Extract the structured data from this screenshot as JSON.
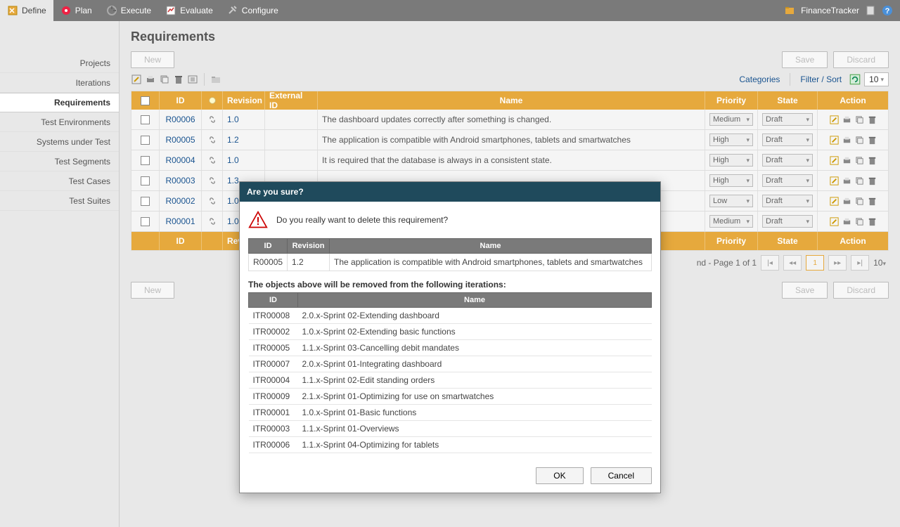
{
  "toolbar": {
    "tabs": [
      "Define",
      "Plan",
      "Execute",
      "Evaluate",
      "Configure"
    ],
    "active_tab": 0,
    "project_label": "FinanceTracker"
  },
  "sidebar": {
    "items": [
      "Projects",
      "Iterations",
      "Requirements",
      "Test Environments",
      "Systems under Test",
      "Test Segments",
      "Test Cases",
      "Test Suites"
    ],
    "active_index": 2
  },
  "page": {
    "title": "Requirements",
    "new_label": "New",
    "save_label": "Save",
    "discard_label": "Discard",
    "categories_label": "Categories",
    "filter_label": "Filter / Sort",
    "page_size": "10"
  },
  "grid": {
    "headers": {
      "id": "ID",
      "revision": "Revision",
      "external_id": "External ID",
      "name": "Name",
      "priority": "Priority",
      "state": "State",
      "action": "Action"
    },
    "rows": [
      {
        "id": "R00006",
        "rev": "1.0",
        "name": "The dashboard updates correctly after something is changed.",
        "priority": "Medium",
        "state": "Draft"
      },
      {
        "id": "R00005",
        "rev": "1.2",
        "name": "The application is compatible with Android smartphones, tablets and smartwatches",
        "priority": "High",
        "state": "Draft"
      },
      {
        "id": "R00004",
        "rev": "1.0",
        "name": "It is required that the database is always in a consistent state.",
        "priority": "High",
        "state": "Draft"
      },
      {
        "id": "R00003",
        "rev": "1.3",
        "name": "",
        "priority": "High",
        "state": "Draft"
      },
      {
        "id": "R00002",
        "rev": "1.0",
        "name": "",
        "priority": "Low",
        "state": "Draft"
      },
      {
        "id": "R00001",
        "rev": "1.0",
        "name": "",
        "priority": "Medium",
        "state": "Draft"
      }
    ],
    "pager_status": "nd - Page 1 of 1",
    "pager_current": "1",
    "pager_size": "10"
  },
  "dialog": {
    "title": "Are you sure?",
    "message": "Do you really want to delete this requirement?",
    "req_headers": {
      "id": "ID",
      "revision": "Revision",
      "name": "Name"
    },
    "req": {
      "id": "R00005",
      "rev": "1.2",
      "name": "The application is compatible with Android smartphones, tablets and smartwatches"
    },
    "iter_intro": "The objects above will be removed from the following iterations:",
    "iter_headers": {
      "id": "ID",
      "name": "Name"
    },
    "iterations": [
      {
        "id": "ITR00008",
        "name": "2.0.x-Sprint 02-Extending dashboard"
      },
      {
        "id": "ITR00002",
        "name": "1.0.x-Sprint 02-Extending basic functions"
      },
      {
        "id": "ITR00005",
        "name": "1.1.x-Sprint 03-Cancelling debit mandates"
      },
      {
        "id": "ITR00007",
        "name": "2.0.x-Sprint 01-Integrating dashboard"
      },
      {
        "id": "ITR00004",
        "name": "1.1.x-Sprint 02-Edit standing orders"
      },
      {
        "id": "ITR00009",
        "name": "2.1.x-Sprint 01-Optimizing for use on smartwatches"
      },
      {
        "id": "ITR00001",
        "name": "1.0.x-Sprint 01-Basic functions"
      },
      {
        "id": "ITR00003",
        "name": "1.1.x-Sprint 01-Overviews"
      },
      {
        "id": "ITR00006",
        "name": "1.1.x-Sprint 04-Optimizing for tablets"
      }
    ],
    "ok_label": "OK",
    "cancel_label": "Cancel"
  }
}
